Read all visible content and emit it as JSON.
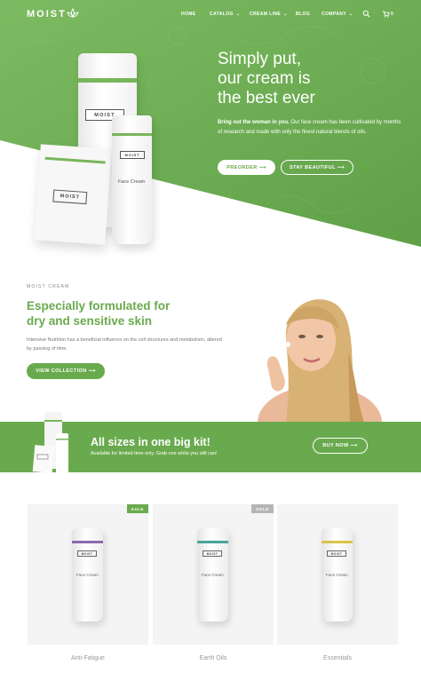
{
  "brand": {
    "name": "MOIST",
    "accent": "#6aaa4e",
    "accent_dark": "#5d9a44"
  },
  "nav": {
    "items": [
      {
        "label": "HOME",
        "has_caret": false
      },
      {
        "label": "CATALOG",
        "has_caret": true
      },
      {
        "label": "CREAM LINE",
        "has_caret": true
      },
      {
        "label": "BLOG",
        "has_caret": false
      },
      {
        "label": "COMPANY",
        "has_caret": true
      }
    ],
    "caret": "⌄",
    "search_icon": "search-icon",
    "cart_icon": "cart-icon",
    "cart_count": "0"
  },
  "hero": {
    "title_line1": "Simply put,",
    "title_line2": "our cream is",
    "title_line3": "the best ever",
    "lead_bold": "Bring out the woman in you.",
    "lead_text": " Our face cream has been cultivated by months of research and made with only the finest natural blends of oils.",
    "btn_preorder": "PREORDER ⟶",
    "btn_beautiful": "STAY BEAUTIFUL ⟶",
    "product_label": "MOIST",
    "product_name": "Face Cream"
  },
  "formulated": {
    "eyebrow": "MOIST CREAM",
    "title_line1": "Especially formulated for",
    "title_line2": "dry and sensitive skin",
    "copy": "Intensive Nutrition has a beneficial influence on the cell structures and metabolism, altered by passing of time.",
    "btn": "VIEW COLLECTION ⟶"
  },
  "banner": {
    "title": "All sizes in one big kit!",
    "subtitle": "Available for limited time only. Grab one while you still can!",
    "btn": "BUY NOW ⟶"
  },
  "products": [
    {
      "title": "Anti-Fatigue",
      "tag": "SALE",
      "tag_color": "#6aaa4e",
      "band_color": "#8a6bb0",
      "label": "MOIST",
      "name": "Face Cream"
    },
    {
      "title": "Earth Oils",
      "tag": "SOLD",
      "tag_color": "#b5b5b5",
      "band_color": "#4aa59a",
      "label": "MOIST",
      "name": "Face Cream"
    },
    {
      "title": "Essentials",
      "tag": "",
      "tag_color": "",
      "band_color": "#d9c54a",
      "label": "MOIST",
      "name": "Face Cream"
    }
  ]
}
